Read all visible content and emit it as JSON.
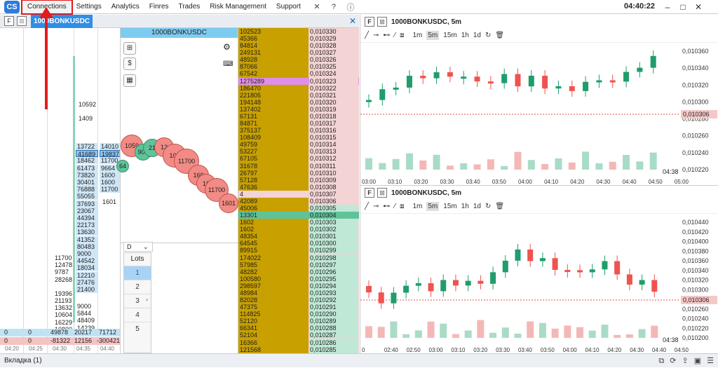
{
  "menu": {
    "items": [
      "Connections",
      "Settings",
      "Analytics",
      "Finres",
      "Trades",
      "Risk Management",
      "Support"
    ],
    "clock": "04:40:22"
  },
  "tab": {
    "f": "F",
    "title": "1000BONKUSDC"
  },
  "middle": {
    "title": "1000BONKUSDC",
    "lots_label": "Lots",
    "lot_dd": "D",
    "lots": [
      "1",
      "2",
      "3",
      "4",
      "5"
    ]
  },
  "cluster": {
    "col1_numbers": [
      "10592",
      "1409",
      "1601"
    ],
    "blue_cells": [
      "13722",
      "41689",
      "18462",
      "61473",
      "73820",
      "30401",
      "76888",
      "55055",
      "37693",
      "23067",
      "44394",
      "22173",
      "13630",
      "41352",
      "80483",
      "9000",
      "44542",
      "18034",
      "12210",
      "27476",
      "21400"
    ],
    "blue2": [
      "14010",
      "19837",
      "11700",
      "9664",
      "1600",
      "1600",
      "11700"
    ],
    "left_nums": [
      "11700",
      "12478",
      "9787",
      "28268",
      "19396",
      "21193",
      "13632",
      "10604",
      "16229",
      "10800"
    ],
    "mid_nums": [
      "9000",
      "5844",
      "48409",
      "14239"
    ],
    "bottom1": [
      "0",
      "0",
      "49878",
      "20217",
      "71712"
    ],
    "bottom2": [
      "0",
      "0",
      "-81322",
      "12156",
      "-300421"
    ],
    "times": [
      "04:20",
      "04:25",
      "04:30",
      "04:35",
      "04:40"
    ]
  },
  "dom": {
    "rows": [
      [
        "102523",
        "0,010330"
      ],
      [
        "45366",
        "0,010329"
      ],
      [
        "84814",
        "0,010328"
      ],
      [
        "249131",
        "0,010327"
      ],
      [
        "48928",
        "0,010326"
      ],
      [
        "87066",
        "0,010325"
      ],
      [
        "67542",
        "0,010324"
      ],
      [
        "1275289",
        "0,010323"
      ],
      [
        "186470",
        "0,010322"
      ],
      [
        "221805",
        "0,010321"
      ],
      [
        "194148",
        "0,010320"
      ],
      [
        "137402",
        "0,010319"
      ],
      [
        "67131",
        "0,010318"
      ],
      [
        "84871",
        "0,010317"
      ],
      [
        "375137",
        "0,010316"
      ],
      [
        "108409",
        "0,010315"
      ],
      [
        "49759",
        "0,010314"
      ],
      [
        "53227",
        "0,010313"
      ],
      [
        "67105",
        "0,010312"
      ],
      [
        "31678",
        "0,010311"
      ],
      [
        "26797",
        "0,010310"
      ],
      [
        "57128",
        "0,010309"
      ],
      [
        "47636",
        "0,010308"
      ],
      [
        "4",
        "0,010307"
      ],
      [
        "42089",
        "0,010306"
      ],
      [
        "45006",
        "0,010305"
      ],
      [
        "13301",
        "0,010304"
      ],
      [
        "1602",
        "0,010303"
      ],
      [
        "1602",
        "0,010302"
      ],
      [
        "48354",
        "0,010301"
      ],
      [
        "64545",
        "0,010300"
      ],
      [
        "89915",
        "0,010299"
      ],
      [
        "174022",
        "0,010298"
      ],
      [
        "57985",
        "0,010297"
      ],
      [
        "48282",
        "0,010296"
      ],
      [
        "100580",
        "0,010295"
      ],
      [
        "298597",
        "0,010294"
      ],
      [
        "48984",
        "0,010293"
      ],
      [
        "82028",
        "0,010292"
      ],
      [
        "47375",
        "0,010291"
      ],
      [
        "114825",
        "0,010290"
      ],
      [
        "52120",
        "0,010289"
      ],
      [
        "66341",
        "0,010288"
      ],
      [
        "52104",
        "0,010287"
      ],
      [
        "16366",
        "0,010286"
      ],
      [
        "121568",
        "0,010285"
      ]
    ]
  },
  "chart1": {
    "f": "F",
    "title": "1000BONKUSDC, 5m",
    "tfs": [
      "1m",
      "5m",
      "15m",
      "1h",
      "1d"
    ],
    "yticks": [
      "0,010360",
      "0,010340",
      "0,010320",
      "0,010300",
      "0,010280",
      "0,010260",
      "0,010240",
      "0,010220"
    ],
    "last": "0,010306",
    "time_label": "04:38",
    "xticks": [
      "03:00",
      "03:10",
      "03:20",
      "03:30",
      "03:40",
      "03:50",
      "04:00",
      "04:10",
      "04:20",
      "04:30",
      "04:40",
      "04:50",
      "05:00"
    ]
  },
  "chart2": {
    "f": "F",
    "title": "1000BONKUSDC, 5m",
    "tfs": [
      "1m",
      "5m",
      "15m",
      "1h",
      "1d"
    ],
    "yticks": [
      "0,010440",
      "0,010420",
      "0,010400",
      "0,010380",
      "0,010360",
      "0,010340",
      "0,010320",
      "0,010300",
      "0,010280",
      "0,010260",
      "0,010240",
      "0,010220",
      "0,010200"
    ],
    "last": "0,010306",
    "time_label": "04:38",
    "xticks": [
      "0",
      "02:40",
      "02:50",
      "03:00",
      "03:10",
      "03:20",
      "03:30",
      "03:40",
      "03:50",
      "04:00",
      "04:10",
      "04:20",
      "04:30",
      "04:40",
      "04:50"
    ]
  },
  "status": {
    "tab": "Вкладка (1)"
  }
}
